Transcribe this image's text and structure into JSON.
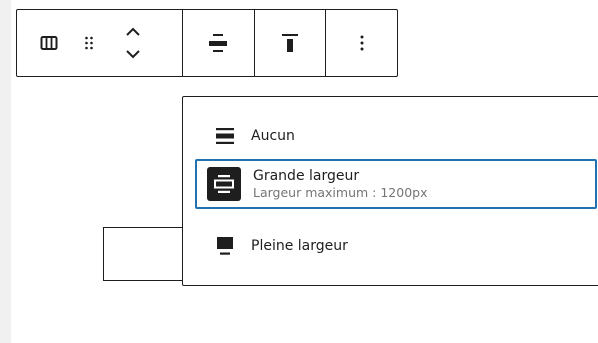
{
  "toolbar": {
    "buttons": [
      {
        "name": "columns",
        "icon": "columns-icon"
      },
      {
        "name": "drag",
        "icon": "drag-handle-icon"
      },
      {
        "name": "move",
        "icon": "move-up-down-icon"
      },
      {
        "name": "align",
        "icon": "align-wide-icon"
      },
      {
        "name": "vertical-align",
        "icon": "align-top-icon"
      },
      {
        "name": "options",
        "icon": "more-vertical-icon"
      }
    ]
  },
  "alignment_menu": {
    "items": [
      {
        "label": "Aucun",
        "icon": "align-none-icon"
      },
      {
        "label": "Grande largeur",
        "description": "Largeur maximum : 1200px",
        "icon": "align-wide-icon",
        "selected": true
      },
      {
        "label": "Pleine largeur",
        "icon": "align-full-icon"
      }
    ]
  },
  "colors": {
    "text": "#1e1e1e",
    "muted": "#757575",
    "focus": "#2271b1"
  }
}
